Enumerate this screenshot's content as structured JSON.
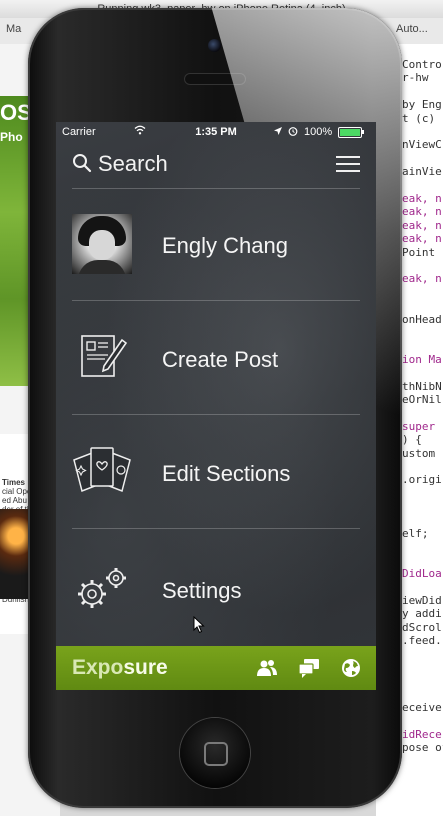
{
  "window": {
    "simulator_title": "Running wk3–paper–hw on iPhone Retina (4–inch)",
    "tab_left": "Ma",
    "tab_right": "Auto..."
  },
  "background_code": [
    "Contro",
    "r-hw",
    "",
    "by Eng",
    "t (c)",
    "",
    "nViewC",
    "",
    "ainVie",
    "",
    "eak, n",
    "eak, n",
    "eak, n",
    "eak, n",
    "Point",
    "",
    "eak, n",
    "",
    "",
    "onHead",
    "",
    "",
    "ion Ma",
    "",
    "thNibN",
    "eOrNil",
    "",
    "super",
    ") {",
    "ustom",
    "",
    ".origi",
    "",
    "",
    "",
    "elf;",
    "",
    "",
    "DidLoa",
    "",
    "iewDid",
    "y addi",
    "dScrol",
    ".feed.",
    "",
    "",
    "",
    "",
    "eceive",
    "",
    "idRece",
    "pose of"
  ],
  "left_pane": {
    "logo_text": "OS",
    "photo_text": "Pho",
    "news_lines": [
      "Times",
      "cial Opera",
      "ed Abu Kh",
      "der of the",
      "L Comme",
      "",
      "",
      "",
      "",
      "",
      "",
      "er Captu",
      "Leader",
      "Dunfish, wh"
    ]
  },
  "status_bar": {
    "carrier": "Carrier",
    "time": "1:35 PM",
    "battery_text": "100%",
    "battery_level": 1.0
  },
  "search": {
    "label": "Search"
  },
  "menu": [
    {
      "label": "Engly Chang",
      "icon": "avatar"
    },
    {
      "label": "Create Post",
      "icon": "create-post-icon"
    },
    {
      "label": "Edit Sections",
      "icon": "cards-icon"
    },
    {
      "label": "Settings",
      "icon": "gears-icon"
    }
  ],
  "bottom_bar": {
    "brand_a": "Expo",
    "brand_b": "sure",
    "icons": [
      "people-icon",
      "chat-icon",
      "globe-icon"
    ]
  },
  "colors": {
    "accent_green": "#6b9416",
    "battery_green": "#4cd964"
  }
}
